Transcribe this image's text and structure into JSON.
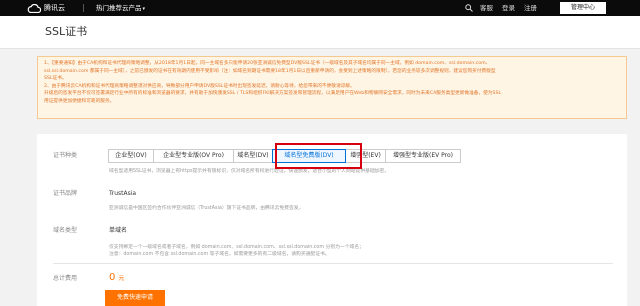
{
  "topbar": {
    "logo_text": "腾讯云",
    "products_label": "热门推荐云产品",
    "caret": "▾",
    "links": [
      "客服",
      "登录",
      "注册"
    ],
    "console_label": "管理中心"
  },
  "page": {
    "title": "SSL证书"
  },
  "notice": {
    "lines": [
      "1、【重要通知】由于CA机构和证书代理商策略调整，从2018年1月1日起，同一主域名多只能申请20张亚洲诚信免费型DV版SSL证书（一级域名及其子域名均属于同一主域，例如 domain.com、ssl.domain.com、",
      "ssl.ssl.domain.com 都属于同一主域），之前已颁发的证书在有效期内使用不受影响（注：如域名到期证书需要18年1月1日以后重新申请的，会受到上述策略的限制），若您的业务较多次调整规则，建议您购买付费版型",
      "SSL证书。",
      "2、由于腾讯云CA机构和证书代理商策略调整须对供应商，导致部分用户申请DV版SSL证书时出现签发延迟，请耐心等待，给您带来的不便敬请谅解。",
      "升级后的签发平台不仅可签署满足行业中所有的标准和浏览器的要求，并有助于加快颁发SSL / TLS和组织FKI解决方案签发和管理流程，以满足用户在Web和物联网安全需求，同时为未来CA服务类型更新做准备，使为SSL",
      "用证提供更加便捷和可靠的服务。"
    ]
  },
  "form": {
    "cert_type": {
      "label": "证书种类",
      "options": [
        "企业型(OV)",
        "企业型专业版(OV Pro)",
        "域名型(DV)",
        "域名型免费版(DV)",
        "增强型(EV)",
        "增强型专业版(EV Pro)"
      ],
      "selected": "域名型免费版(DV)",
      "description": "域名型适用SSL证书，浏览器上有https提示并有锁标识，仅对域名所有权进行验证，快速颁发，适合小型的个人网站提供基础加密。"
    },
    "brand": {
      "label": "证书品牌",
      "value": "TrustAsia",
      "description": "亚洲诚信是中国区签约合作伙伴亚洲诚信（TrustAsia）旗下证书品牌，由腾讯云免费签发。"
    },
    "domain_type": {
      "label": "域名类型",
      "value": "单域名",
      "description_1": "仅支持绑定一个一级域名或者子域名，例如 domain.com、ssl.domain.com、ssl.ssl.domain.com 分别为一个域名；",
      "description_2": "注意：domain.com 不包含 ssl.domain.com 等子域名，如需要更多的有二级域名，请购买通配证书。"
    },
    "total": {
      "label": "总计费用",
      "price": "0",
      "unit": "元"
    },
    "apply_button": "免费快速申请"
  },
  "colors": {
    "accent": "#0070d6",
    "price": "#ff7200",
    "highlight_box": "#d7000f",
    "notice_text": "#e0762a"
  }
}
